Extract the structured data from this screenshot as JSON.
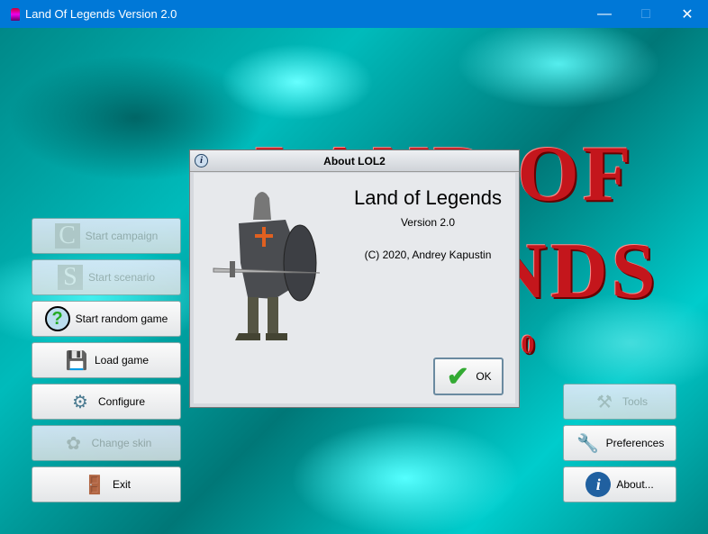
{
  "window": {
    "title": "Land Of Legends Version 2.0",
    "controls": [
      "minimize",
      "maximize",
      "close"
    ]
  },
  "logo": {
    "line1": "LAND OF",
    "line2": "LEGENDS",
    "line3": "2.0"
  },
  "left_menu": [
    {
      "label": "Start campaign",
      "icon": "campaign-letter-c-icon",
      "enabled": false
    },
    {
      "label": "Start scenario",
      "icon": "scenario-letter-s-icon",
      "enabled": false
    },
    {
      "label": "Start random game",
      "icon": "question-cloud-icon",
      "enabled": true
    },
    {
      "label": "Load game",
      "icon": "load-disk-icon",
      "enabled": true
    },
    {
      "label": "Configure",
      "icon": "gear-icon",
      "enabled": true
    },
    {
      "label": "Change skin",
      "icon": "skin-icon",
      "enabled": false
    },
    {
      "label": "Exit",
      "icon": "exit-door-icon",
      "enabled": true
    }
  ],
  "right_menu": [
    {
      "label": "Tools",
      "icon": "tools-icon",
      "enabled": false
    },
    {
      "label": "Preferences",
      "icon": "wrench-icon",
      "enabled": true
    },
    {
      "label": "About...",
      "icon": "info-icon",
      "enabled": true
    }
  ],
  "about_dialog": {
    "title": "About LOL2",
    "app_name": "Land of Legends",
    "version": "Version 2.0",
    "copyright": "(C) 2020, Andrey Kapustin",
    "ok_label": "OK"
  },
  "colors": {
    "titlebar": "#0078d7",
    "logo_red": "#c4161c",
    "background": "#00aaaa"
  }
}
